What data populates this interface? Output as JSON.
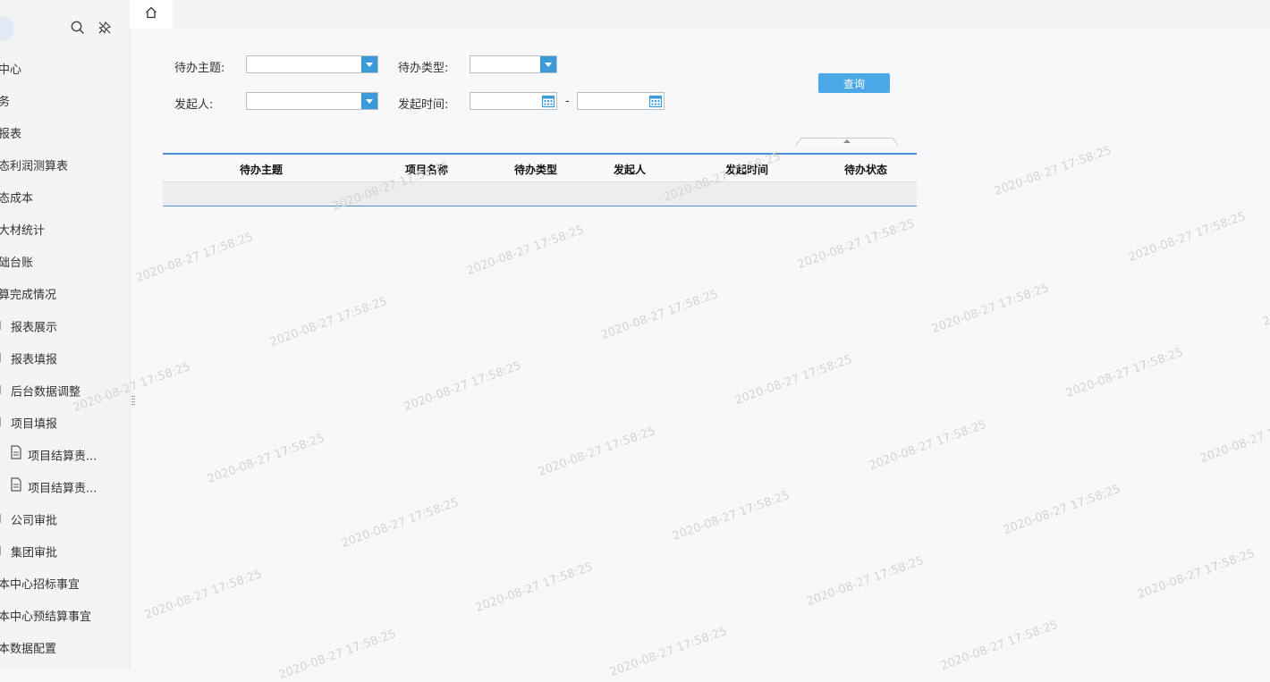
{
  "sidebar": {
    "items": [
      {
        "label": "中心"
      },
      {
        "label": "务"
      },
      {
        "label": "报表"
      },
      {
        "label": "态利润测算表"
      },
      {
        "label": "态成本"
      },
      {
        "label": "大材统计"
      },
      {
        "label": "础台账"
      },
      {
        "label": "算完成情况"
      },
      {
        "label": "报表展示"
      },
      {
        "label": "报表填报"
      },
      {
        "label": "后台数据调整"
      },
      {
        "label": "项目填报"
      },
      {
        "label": "项目结算责..."
      },
      {
        "label": "项目结算责..."
      },
      {
        "label": "公司审批"
      },
      {
        "label": "集团审批"
      },
      {
        "label": "本中心招标事宜"
      },
      {
        "label": "本中心预结算事宜"
      },
      {
        "label": "本数据配置"
      }
    ]
  },
  "filters": {
    "subject_label": "待办主题:",
    "type_label": "待办类型:",
    "initiator_label": "发起人:",
    "time_label": "发起时间:",
    "range_sep": "-",
    "query_button": "查询"
  },
  "table": {
    "columns": [
      "待办主题",
      "项目名称",
      "待办类型",
      "发起人",
      "发起时间",
      "待办状态"
    ]
  },
  "watermark": "2020-08-27 17:58:25",
  "colors": {
    "accent": "#4aa8e6",
    "dropdown": "#3d9ad8",
    "table_border": "#4a90d9"
  }
}
